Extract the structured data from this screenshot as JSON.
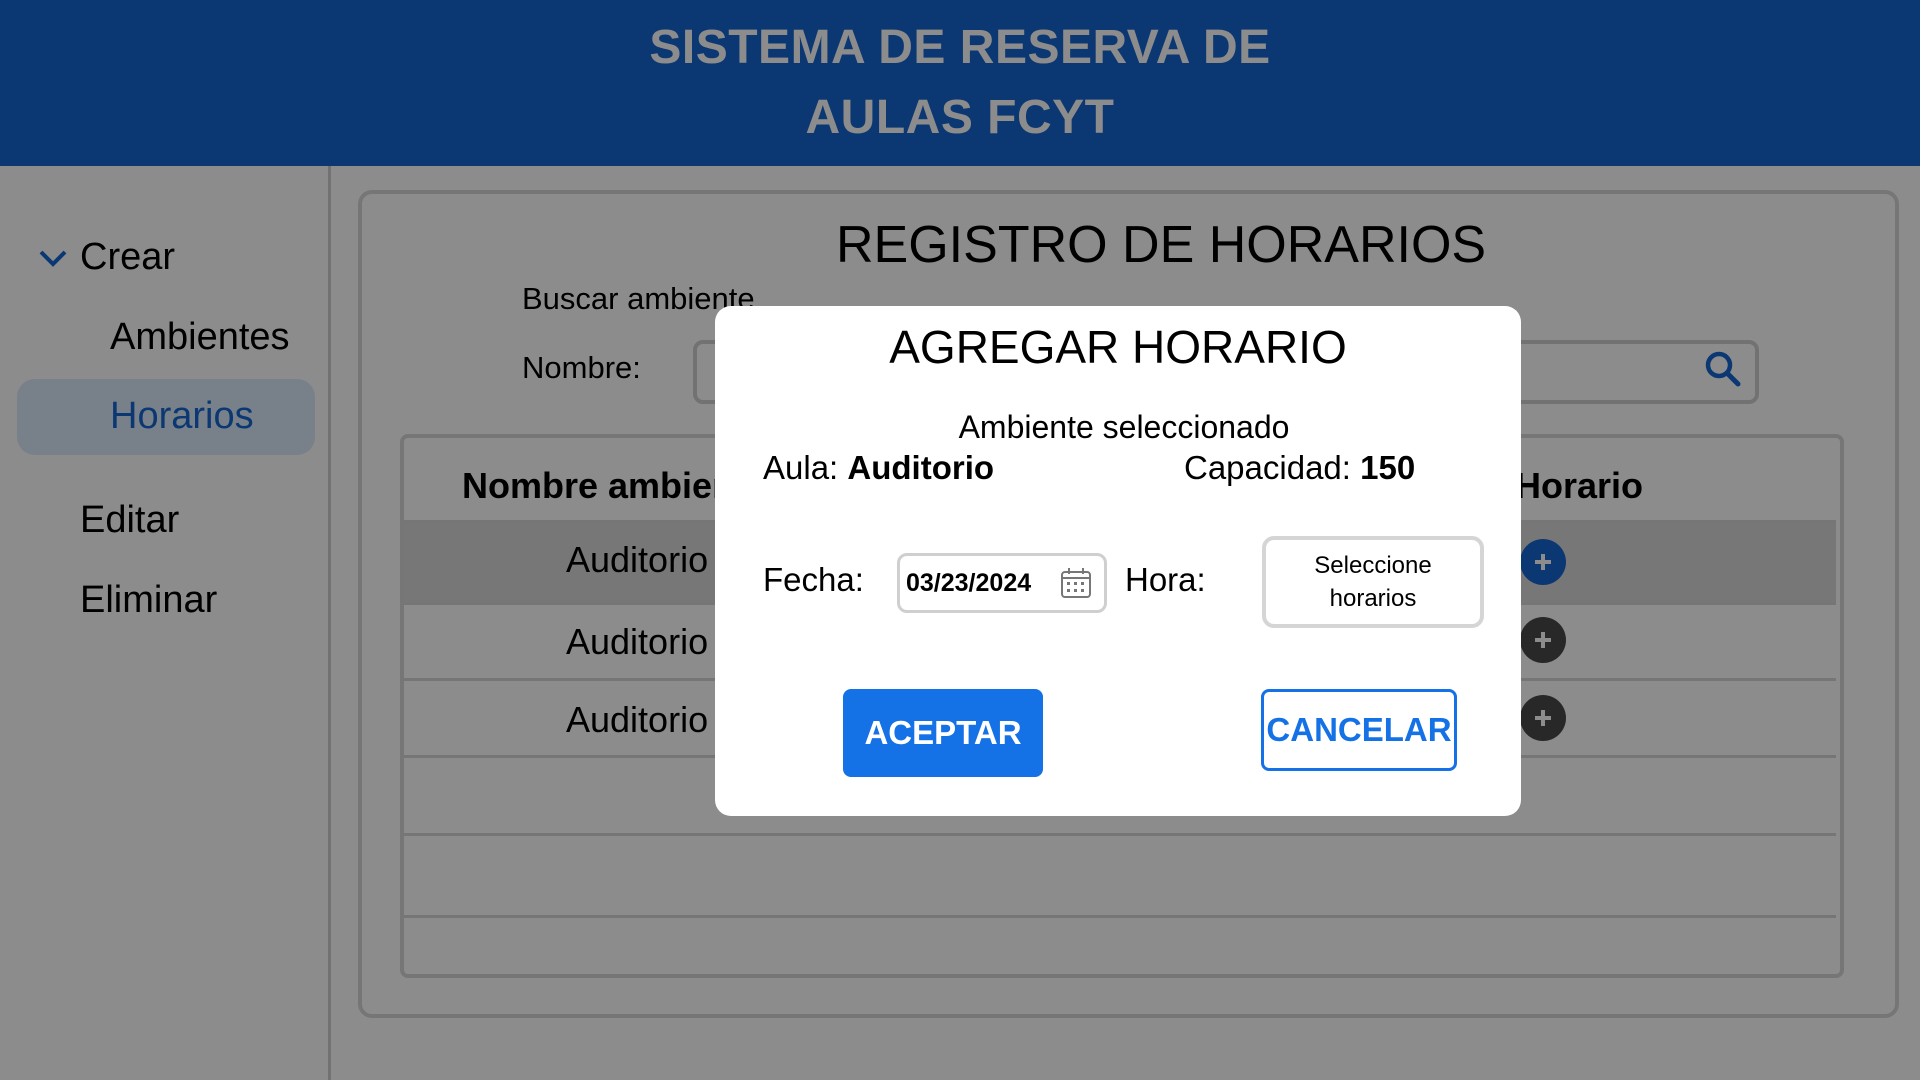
{
  "header": {
    "title_line1": "SISTEMA DE RESERVA DE",
    "title_line2": "AULAS FCYT"
  },
  "sidebar": {
    "items": [
      {
        "label": "Crear",
        "icon": "chevron-down-icon"
      },
      {
        "label": "Ambientes"
      },
      {
        "label": "Horarios",
        "active": true
      },
      {
        "label": "Editar"
      },
      {
        "label": "Eliminar"
      }
    ]
  },
  "main": {
    "title": "REGISTRO DE HORARIOS",
    "search_label": "Buscar ambiente",
    "name_label": "Nombre:",
    "search_value": "",
    "table": {
      "headers": [
        "Nombre ambiente",
        "Horario"
      ],
      "rows": [
        {
          "name": "Auditorio",
          "selected": true
        },
        {
          "name": "Auditorio",
          "selected": false
        },
        {
          "name": "Auditorio",
          "selected": false
        }
      ]
    }
  },
  "modal": {
    "title": "AGREGAR HORARIO",
    "subtitle": "Ambiente seleccionado",
    "aula_label": "Aula:",
    "aula_value": "Auditorio",
    "capacidad_label": "Capacidad:",
    "capacidad_value": "150",
    "fecha_label": "Fecha:",
    "fecha_value": "03/23/2024",
    "hora_label": "Hora:",
    "hora_placeholder": "Seleccione\nhorarios",
    "accept_label": "ACEPTAR",
    "cancel_label": "CANCELAR"
  },
  "colors": {
    "brand_blue": "#1466d1",
    "button_blue": "#1571e6",
    "active_bg": "#dbeaf9",
    "selected_row": "#d9d9d9",
    "plus_gray": "#4a4a4a"
  }
}
